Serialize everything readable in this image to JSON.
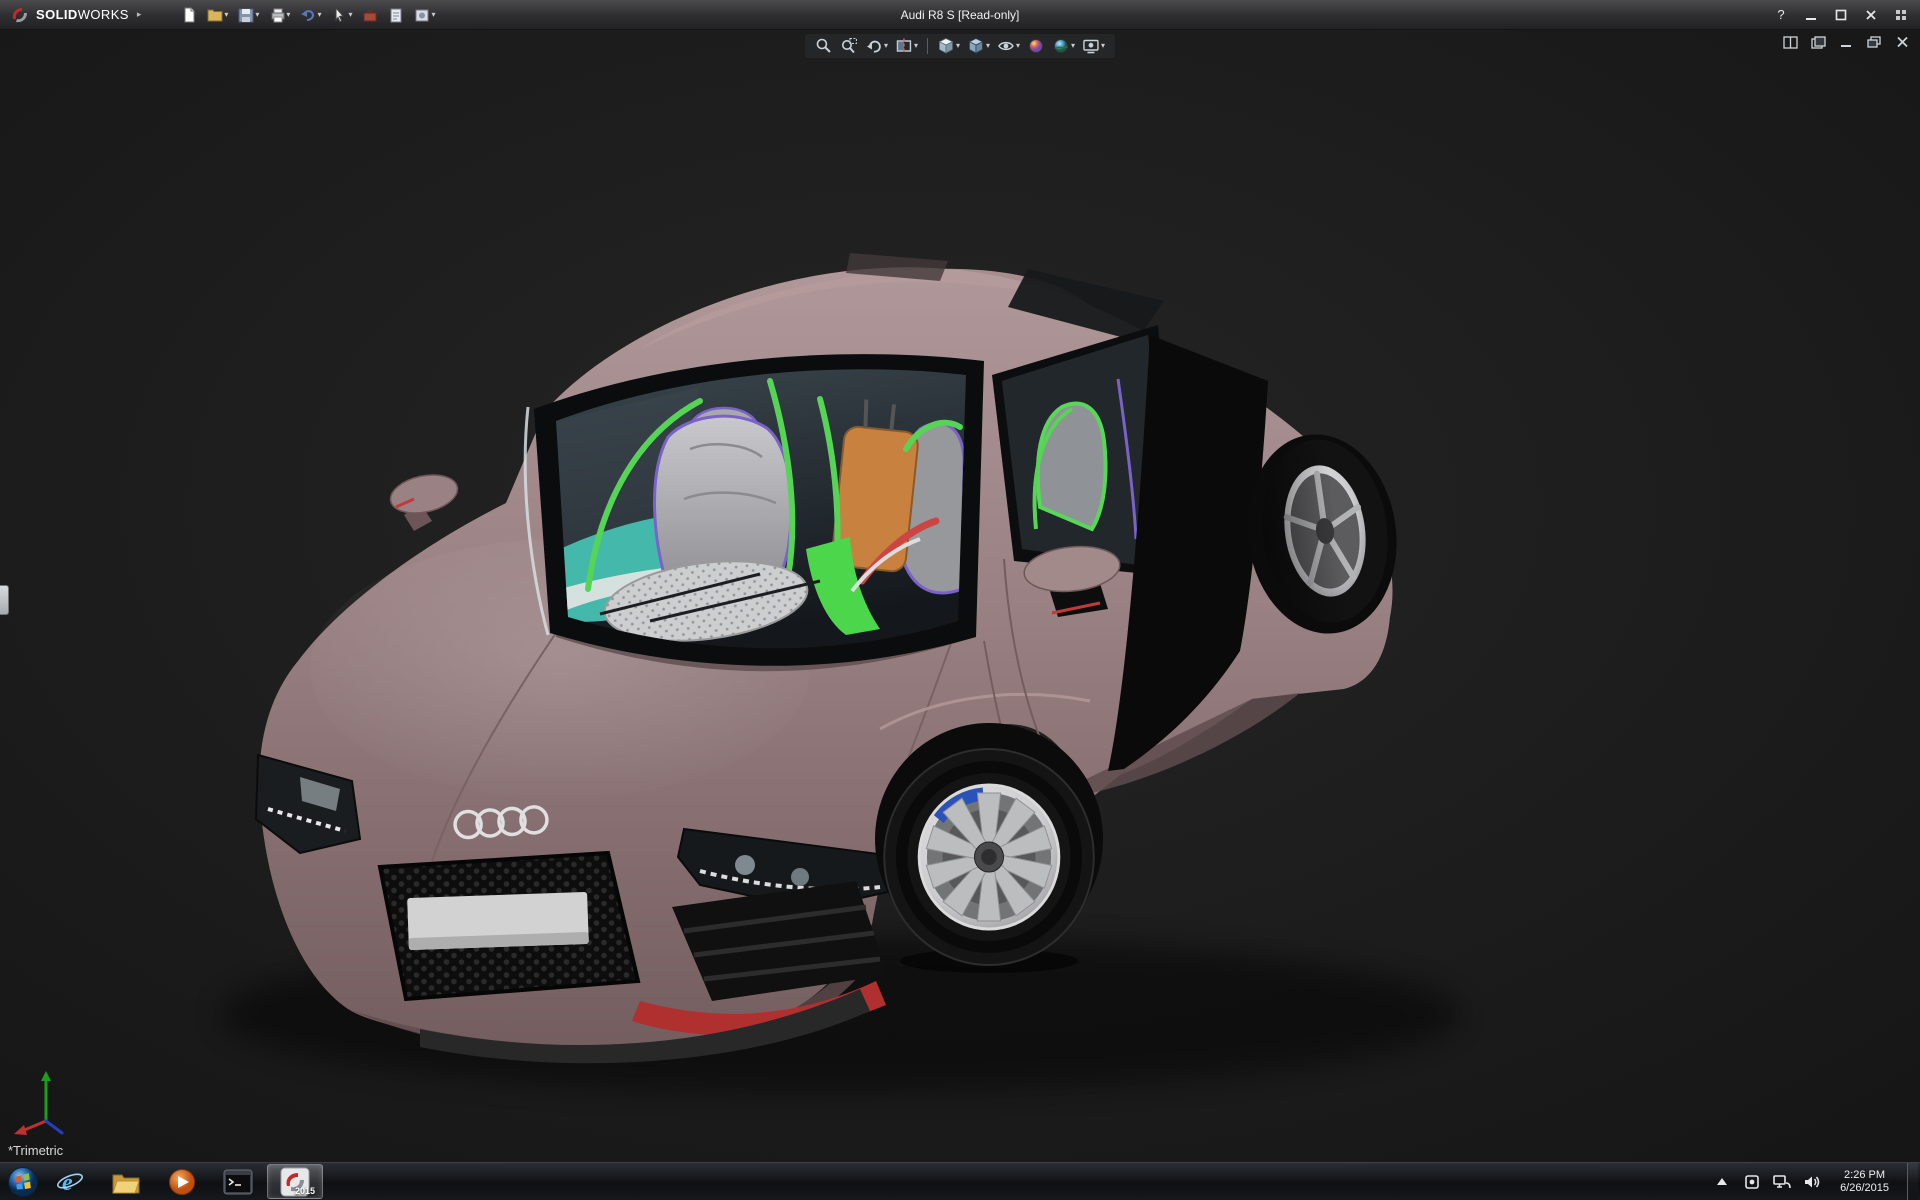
{
  "window": {
    "app_name_bold": "SOLID",
    "app_name_light": "WORKS",
    "title": "Audi R8 S [Read-only]",
    "help_label": "?",
    "controls": [
      "help",
      "minimize",
      "maximize",
      "close",
      "expand"
    ]
  },
  "main_toolbar": {
    "items": [
      {
        "name": "new-document",
        "dropdown": false
      },
      {
        "name": "open",
        "dropdown": true
      },
      {
        "name": "save",
        "dropdown": true
      },
      {
        "name": "print",
        "dropdown": true
      },
      {
        "name": "undo",
        "dropdown": true
      },
      {
        "name": "select",
        "dropdown": true
      },
      {
        "name": "toolbox",
        "dropdown": false
      },
      {
        "name": "file-properties",
        "dropdown": false
      },
      {
        "name": "options",
        "dropdown": true
      }
    ]
  },
  "heads_up_toolbar": {
    "items": [
      "zoom-to-fit",
      "zoom-to-area",
      "previous-view",
      "section-view",
      "view-orientation",
      "display-style",
      "hide-show-items",
      "edit-appearance",
      "apply-scene",
      "view-settings"
    ]
  },
  "document_controls": [
    "split-view",
    "new-window",
    "minimize-document",
    "restore-document",
    "close-document"
  ],
  "viewport": {
    "view_label": "*Trimetric",
    "model_name": "Audi R8 S",
    "triad_axes": [
      "X",
      "Y",
      "Z"
    ]
  },
  "taskbar": {
    "items": [
      {
        "name": "start"
      },
      {
        "name": "internet-explorer"
      },
      {
        "name": "file-explorer"
      },
      {
        "name": "media-player"
      },
      {
        "name": "command-prompt"
      },
      {
        "name": "solidworks-2015",
        "label": "2015",
        "active": true
      }
    ],
    "tray": {
      "icons": [
        "expand-tray",
        "tray-app",
        "network",
        "volume"
      ],
      "clock_time": "2:26 PM",
      "clock_date": "6/26/2015"
    }
  },
  "colors": {
    "car_body": "#9a8183",
    "accent_red": "#b03030",
    "cage_green": "#55d455",
    "dash_teal": "#45b8ac",
    "interior_orange": "#c9813f",
    "viewport_bg": "#1b1b1b",
    "titlebar_bg": "#333335"
  }
}
